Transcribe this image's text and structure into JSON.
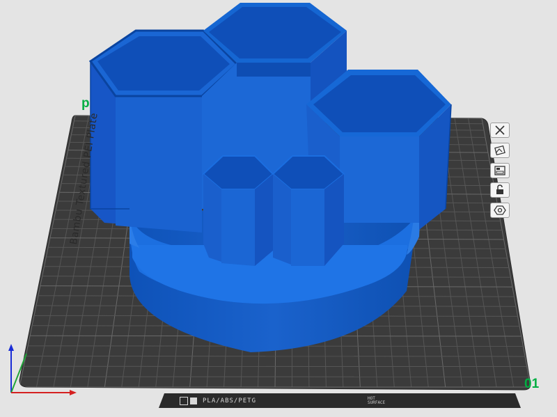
{
  "plate": {
    "name": "Bambu Textured PEI Plate",
    "number": "01",
    "corner_label": "p",
    "filament_types": "PLA/ABS/PETG",
    "hot_surface": "HOT\nSURFACE"
  },
  "side_toolbar": {
    "icons": [
      "close-icon",
      "orient-icon",
      "arrange-icon",
      "lock-icon",
      "settings-hex-icon"
    ]
  },
  "colors": {
    "model_blue": "#1f6fdc",
    "model_blue_dark": "#0d50b5",
    "model_blue_light": "#3c8ce8",
    "plate_dark": "#3b3b3b",
    "grid_line": "#5a5a5a",
    "accent_green": "#00ae42",
    "background": "#e4e4e4"
  }
}
